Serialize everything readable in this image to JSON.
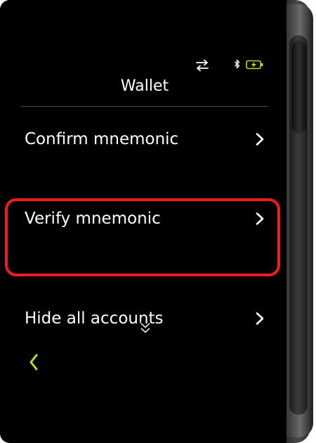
{
  "screen": {
    "title": "Wallet",
    "status": {
      "transfer_icon": "transfer-arrows-icon",
      "bluetooth_icon": "bluetooth-icon",
      "battery_icon": "battery-charging-icon",
      "battery_color": "#b6e21f"
    },
    "menu_items": [
      {
        "label": "Confirm mnemonic",
        "icon": "chevron-right-icon"
      },
      {
        "label": "Verify mnemonic",
        "icon": "chevron-right-icon"
      },
      {
        "label": "Hide all accounts",
        "icon": "chevron-right-icon"
      }
    ],
    "back_icon": "chevron-left-icon",
    "back_color": "#b6e21f",
    "highlight_color": "#ef1c1c"
  }
}
